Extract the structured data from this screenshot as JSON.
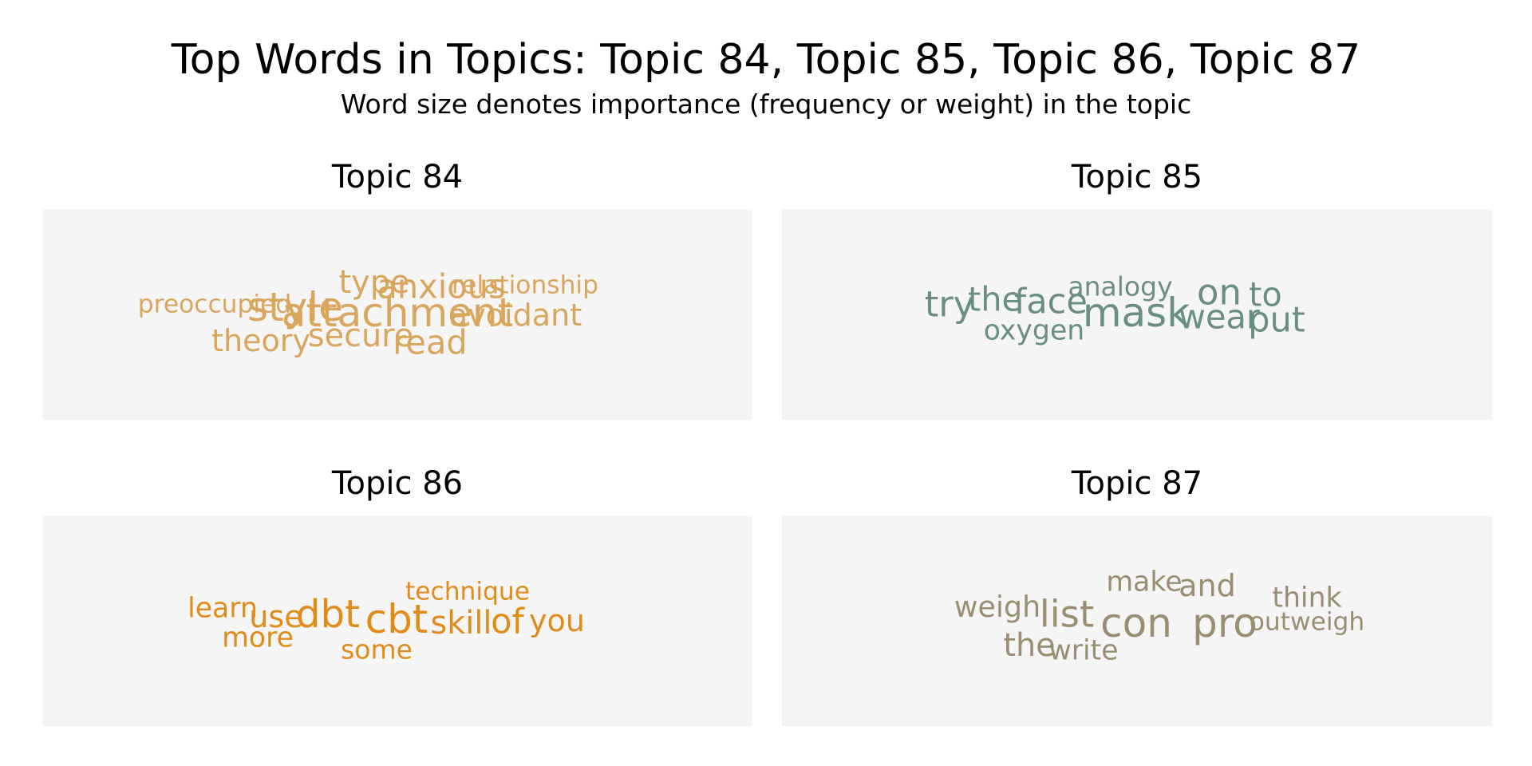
{
  "title": "Top Words in Topics: Topic 84, Topic 85, Topic 86, Topic 87",
  "subtitle": "Word size denotes importance (frequency or weight) in the topic",
  "chart_data": [
    {
      "type": "wordcloud",
      "title": "Topic 84",
      "color": "#d9a65e",
      "words": [
        {
          "text": "attachment",
          "weight": 1.0
        },
        {
          "text": "style",
          "weight": 1.0
        },
        {
          "text": "anxious",
          "weight": 0.75
        },
        {
          "text": "read",
          "weight": 0.75
        },
        {
          "text": "type",
          "weight": 0.7
        },
        {
          "text": "secure",
          "weight": 0.7
        },
        {
          "text": "avoidant",
          "weight": 0.65
        },
        {
          "text": "theory",
          "weight": 0.65
        },
        {
          "text": "relationship",
          "weight": 0.45
        },
        {
          "text": "preoccupied",
          "weight": 0.45
        }
      ]
    },
    {
      "type": "wordcloud",
      "title": "Topic 85",
      "color": "#6b8f7e",
      "words": [
        {
          "text": "mask",
          "weight": 1.0
        },
        {
          "text": "on",
          "weight": 0.85
        },
        {
          "text": "try",
          "weight": 0.85
        },
        {
          "text": "face",
          "weight": 0.8
        },
        {
          "text": "put",
          "weight": 0.8
        },
        {
          "text": "the",
          "weight": 0.75
        },
        {
          "text": "to",
          "weight": 0.75
        },
        {
          "text": "wear",
          "weight": 0.75
        },
        {
          "text": "oxygen",
          "weight": 0.55
        },
        {
          "text": "analogy",
          "weight": 0.5
        }
      ]
    },
    {
      "type": "wordcloud",
      "title": "Topic 86",
      "color": "#e08c1a",
      "words": [
        {
          "text": "cbt",
          "weight": 1.0
        },
        {
          "text": "dbt",
          "weight": 0.95
        },
        {
          "text": "of",
          "weight": 0.8
        },
        {
          "text": "skill",
          "weight": 0.7
        },
        {
          "text": "use",
          "weight": 0.65
        },
        {
          "text": "you",
          "weight": 0.65
        },
        {
          "text": "learn",
          "weight": 0.55
        },
        {
          "text": "more",
          "weight": 0.55
        },
        {
          "text": "some",
          "weight": 0.5
        },
        {
          "text": "technique",
          "weight": 0.45
        }
      ]
    },
    {
      "type": "wordcloud",
      "title": "Topic 87",
      "color": "#9a8e72",
      "words": [
        {
          "text": "pro",
          "weight": 1.0
        },
        {
          "text": "con",
          "weight": 1.0
        },
        {
          "text": "list",
          "weight": 0.9
        },
        {
          "text": "the",
          "weight": 0.7
        },
        {
          "text": "and",
          "weight": 0.65
        },
        {
          "text": "weigh",
          "weight": 0.6
        },
        {
          "text": "write",
          "weight": 0.55
        },
        {
          "text": "think",
          "weight": 0.55
        },
        {
          "text": "make",
          "weight": 0.55
        },
        {
          "text": "outweigh",
          "weight": 0.45
        }
      ]
    }
  ]
}
